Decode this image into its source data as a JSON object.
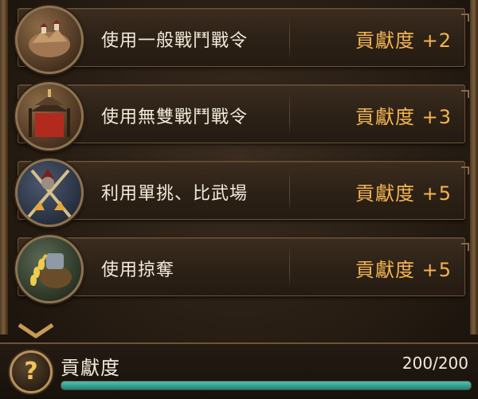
{
  "rows": [
    {
      "label": "使用一般戰鬥戰令",
      "reward": "貢獻度 +2",
      "icon": "map-terrain-icon"
    },
    {
      "label": "使用無雙戰鬥戰令",
      "reward": "貢獻度 +3",
      "icon": "pagoda-banner-icon"
    },
    {
      "label": "利用單挑、比武場",
      "reward": "貢獻度 +5",
      "icon": "crossed-spears-icon"
    },
    {
      "label": "使用掠奪",
      "reward": "貢獻度 +5",
      "icon": "plunder-grain-icon"
    }
  ],
  "footer": {
    "help_glyph": "?",
    "title": "貢獻度",
    "value_text": "200/200",
    "progress": 1.0,
    "progress_color": "#2fa696"
  },
  "colors": {
    "reward_text": "#f3b452",
    "label_text": "#f3ead9"
  }
}
